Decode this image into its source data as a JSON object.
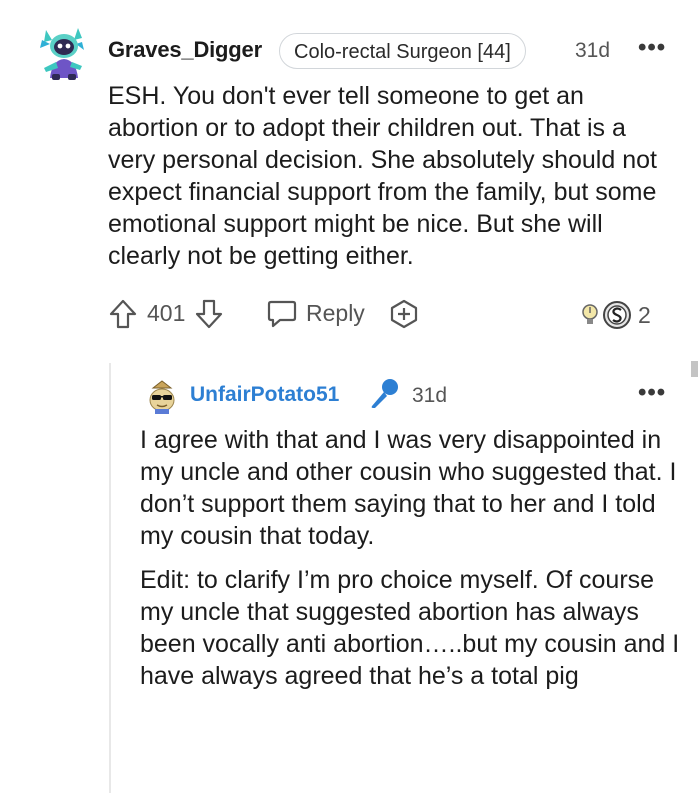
{
  "comment": {
    "author": "Graves_Digger",
    "flair": "Colo-rectal Surgeon [44]",
    "time": "31d",
    "more": "•••",
    "body": "ESH. You don't ever tell someone to get an abortion or to adopt their children out. That is a very personal decision. She absolutely should not expect financial support from the family, but some emotional support might be nice. But she will clearly not be getting either.",
    "score": "401",
    "reply_label": "Reply",
    "award_count": "2",
    "icons": {
      "avatar": "snoo-avatar-icon",
      "upvote": "upvote-arrow-icon",
      "downvote": "downvote-arrow-icon",
      "reply": "reply-bubble-icon",
      "award": "add-award-icon",
      "award_badges": "award-badge-icon"
    }
  },
  "reply": {
    "author": "UnfairPotato51",
    "time": "31d",
    "more": "•••",
    "paragraphs": [
      "I agree with that and I was very disappointed in my uncle and other cousin who suggested that. I don’t support them saying that to her and I told my cousin that today.",
      "Edit: to clarify I’m pro choice myself. Of course my uncle that suggested abortion has always been vocally anti abortion…..but my cousin and I have always agreed that he’s a total pig"
    ],
    "icons": {
      "avatar": "potato-avatar-icon",
      "op_badge": "microphone-icon"
    }
  },
  "colors": {
    "text": "#1c1c1c",
    "meta": "#555555",
    "link_blue": "#2d7fd3",
    "flair_border": "#d2d6da",
    "thread_line": "#e8e8e8"
  }
}
